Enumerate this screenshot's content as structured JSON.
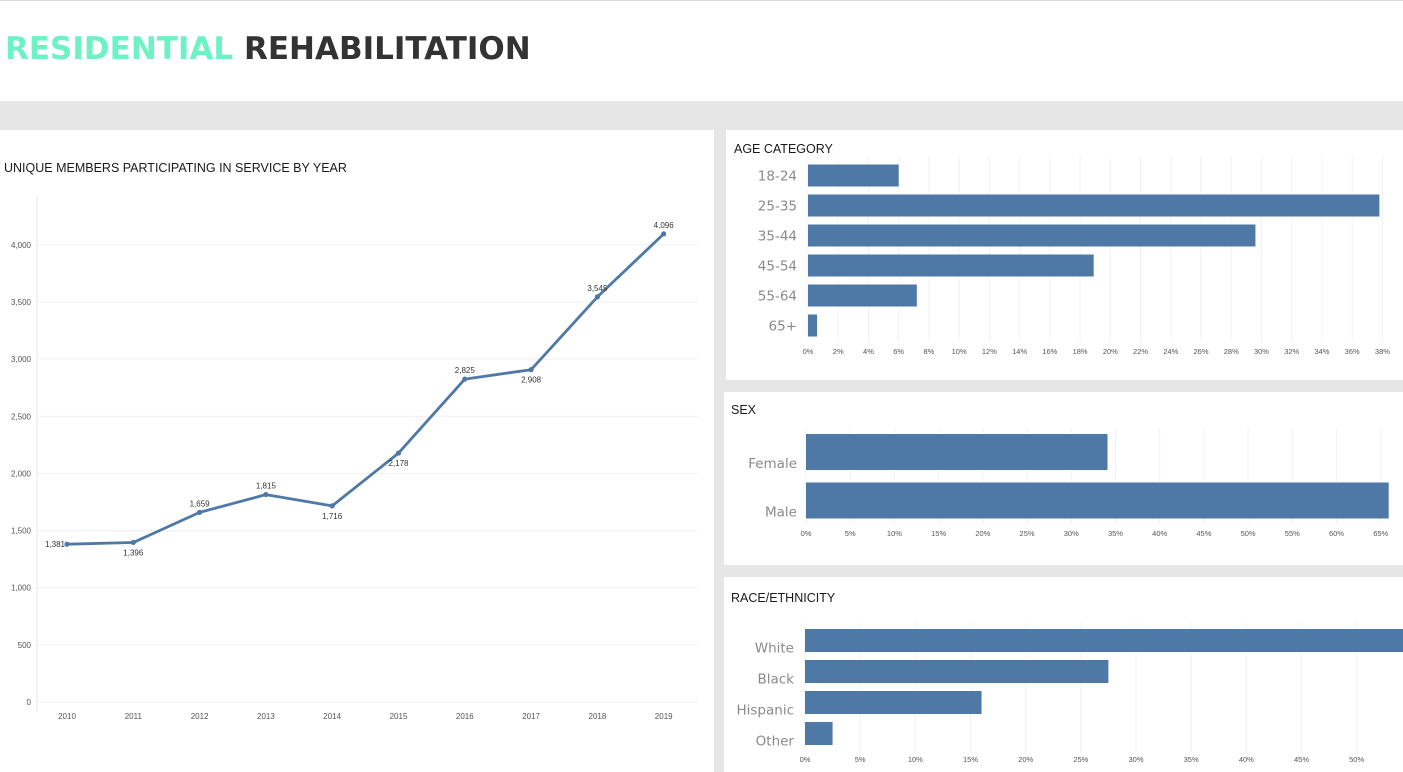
{
  "header": {
    "title_accent": "RESIDENTIAL",
    "title_main": "REHABILITATION",
    "accent_color": "#6ef2c4"
  },
  "bar_color": "#4e79a7",
  "line_chart": {
    "title": "UNIQUE MEMBERS PARTICIPATING IN SERVICE BY YEAR"
  },
  "age_chart": {
    "title": "AGE CATEGORY"
  },
  "sex_chart": {
    "title": "SEX"
  },
  "race_chart": {
    "title": "RACE/ETHNICITY"
  },
  "chart_data": [
    {
      "type": "line",
      "title": "UNIQUE MEMBERS PARTICIPATING IN SERVICE BY YEAR",
      "x": [
        "2010",
        "2011",
        "2012",
        "2013",
        "2014",
        "2015",
        "2016",
        "2017",
        "2018",
        "2019"
      ],
      "values": [
        1381,
        1396,
        1659,
        1815,
        1716,
        2178,
        2825,
        2908,
        3545,
        4096
      ],
      "data_labels": [
        "1,381",
        "1,396",
        "1,659",
        "1,815",
        "1,716",
        "2,178",
        "2,825",
        "2,908",
        "3,545",
        "4,096"
      ],
      "ylim": [
        0,
        4200
      ],
      "y_ticks": [
        0,
        500,
        1000,
        1500,
        2000,
        2500,
        3000,
        3500,
        4000
      ],
      "y_tick_labels": [
        "0",
        "500",
        "1,000",
        "1,500",
        "2,000",
        "2,500",
        "3,000",
        "3,500",
        "4,000"
      ],
      "grid": true
    },
    {
      "type": "bar",
      "orientation": "horizontal",
      "title": "AGE CATEGORY",
      "categories": [
        "18-24",
        "25-35",
        "35-44",
        "45-54",
        "55-64",
        "65+"
      ],
      "values": [
        6.0,
        37.8,
        29.6,
        18.9,
        7.2,
        0.6
      ],
      "x_ticks": [
        0,
        2,
        4,
        6,
        8,
        10,
        12,
        14,
        16,
        18,
        20,
        22,
        24,
        26,
        28,
        30,
        32,
        34,
        36,
        38
      ],
      "x_tick_labels": [
        "0%",
        "2%",
        "4%",
        "6%",
        "8%",
        "10%",
        "12%",
        "14%",
        "16%",
        "18%",
        "20%",
        "22%",
        "24%",
        "26%",
        "28%",
        "30%",
        "32%",
        "34%",
        "36%",
        "38%"
      ],
      "xlim": [
        0,
        38.7
      ],
      "grid": true
    },
    {
      "type": "bar",
      "orientation": "horizontal",
      "title": "SEX",
      "categories": [
        "Female",
        "Male"
      ],
      "values": [
        34.1,
        65.9
      ],
      "x_ticks": [
        0,
        5,
        10,
        15,
        20,
        25,
        30,
        35,
        40,
        45,
        50,
        55,
        60,
        65
      ],
      "x_tick_labels": [
        "0%",
        "5%",
        "10%",
        "15%",
        "20%",
        "25%",
        "30%",
        "35%",
        "40%",
        "45%",
        "50%",
        "55%",
        "60%",
        "65%"
      ],
      "xlim": [
        0,
        66.5
      ],
      "grid": true
    },
    {
      "type": "bar",
      "orientation": "horizontal",
      "title": "RACE/ETHNICITY",
      "categories": [
        "White",
        "Black",
        "Hispanic",
        "Other"
      ],
      "values": [
        54.2,
        27.5,
        16.0,
        2.5
      ],
      "x_ticks": [
        0,
        5,
        10,
        15,
        20,
        25,
        30,
        35,
        40,
        45,
        50
      ],
      "x_tick_labels": [
        "0%",
        "5%",
        "10%",
        "15%",
        "20%",
        "25%",
        "30%",
        "35%",
        "40%",
        "45%",
        "50%"
      ],
      "xlim": [
        0,
        54.2
      ],
      "grid": true
    }
  ]
}
